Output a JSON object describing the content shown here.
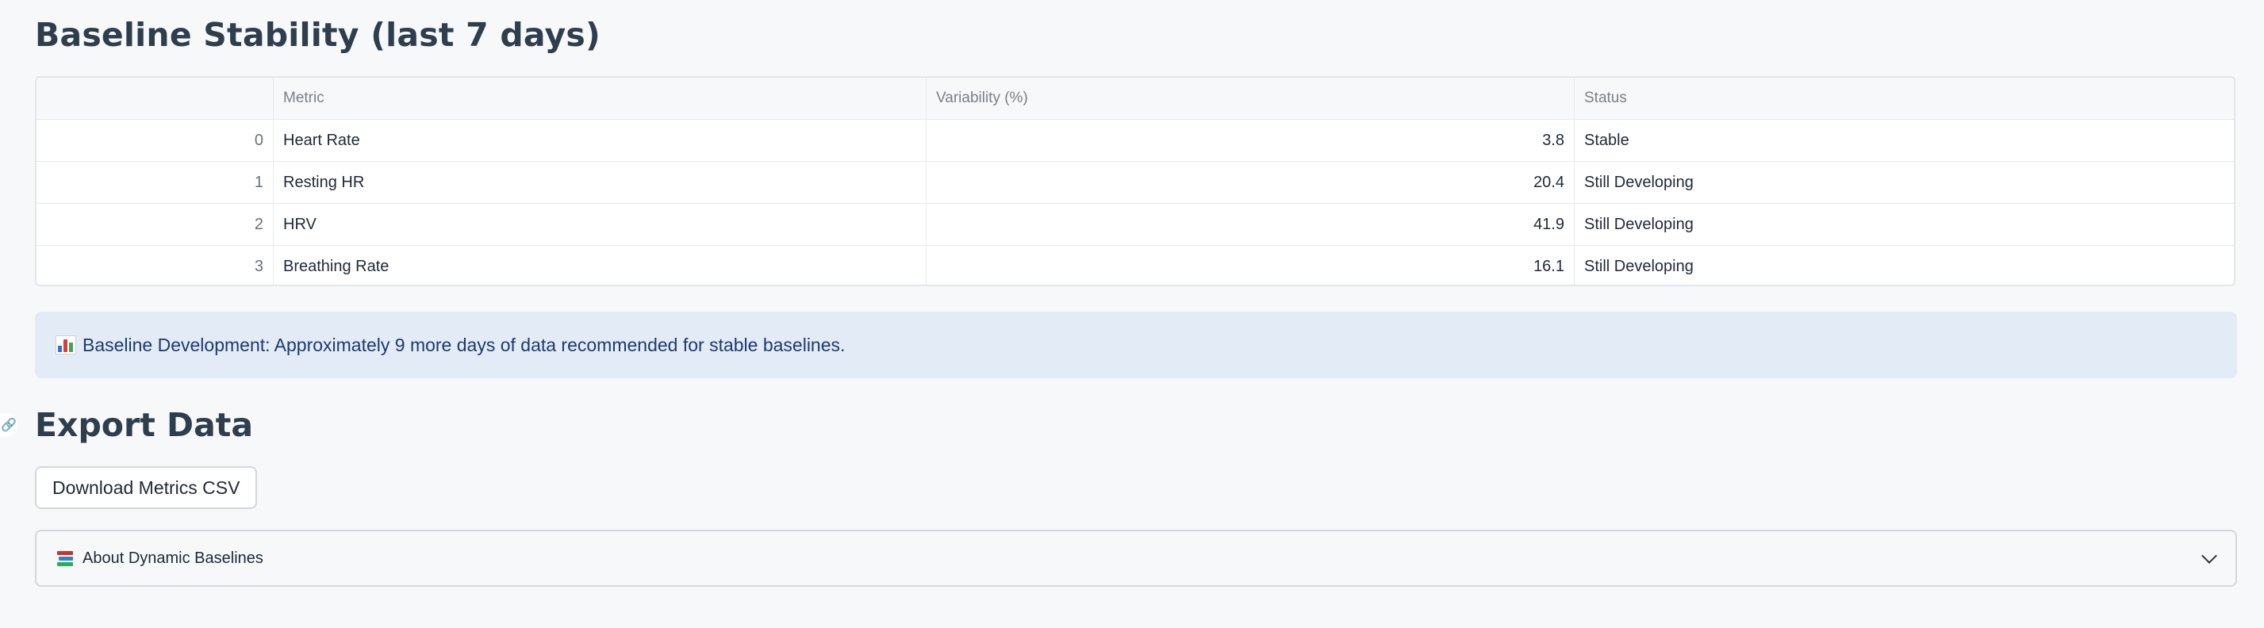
{
  "baseline": {
    "title": "Baseline Stability (last 7 days)",
    "columns": [
      "",
      "Metric",
      "Variability (%)",
      "Status"
    ],
    "rows": [
      {
        "index": "0",
        "metric": "Heart Rate",
        "variability": "3.8",
        "status": "Stable"
      },
      {
        "index": "1",
        "metric": "Resting HR",
        "variability": "20.4",
        "status": "Still Developing"
      },
      {
        "index": "2",
        "metric": "HRV",
        "variability": "41.9",
        "status": "Still Developing"
      },
      {
        "index": "3",
        "metric": "Breathing Rate",
        "variability": "16.1",
        "status": "Still Developing"
      }
    ]
  },
  "info": {
    "icon": "bar-chart-icon",
    "text": "Baseline Development: Approximately 9 more days of data recommended for stable baselines."
  },
  "export": {
    "title": "Export Data",
    "download_label": "Download Metrics CSV"
  },
  "expander": {
    "icon": "books-icon",
    "label": "About Dynamic Baselines"
  },
  "colors": {
    "background": "#f6f8fa",
    "heading": "#2f3e4d",
    "info_bg": "#e3ebf6",
    "info_text": "#1d3a6e"
  }
}
